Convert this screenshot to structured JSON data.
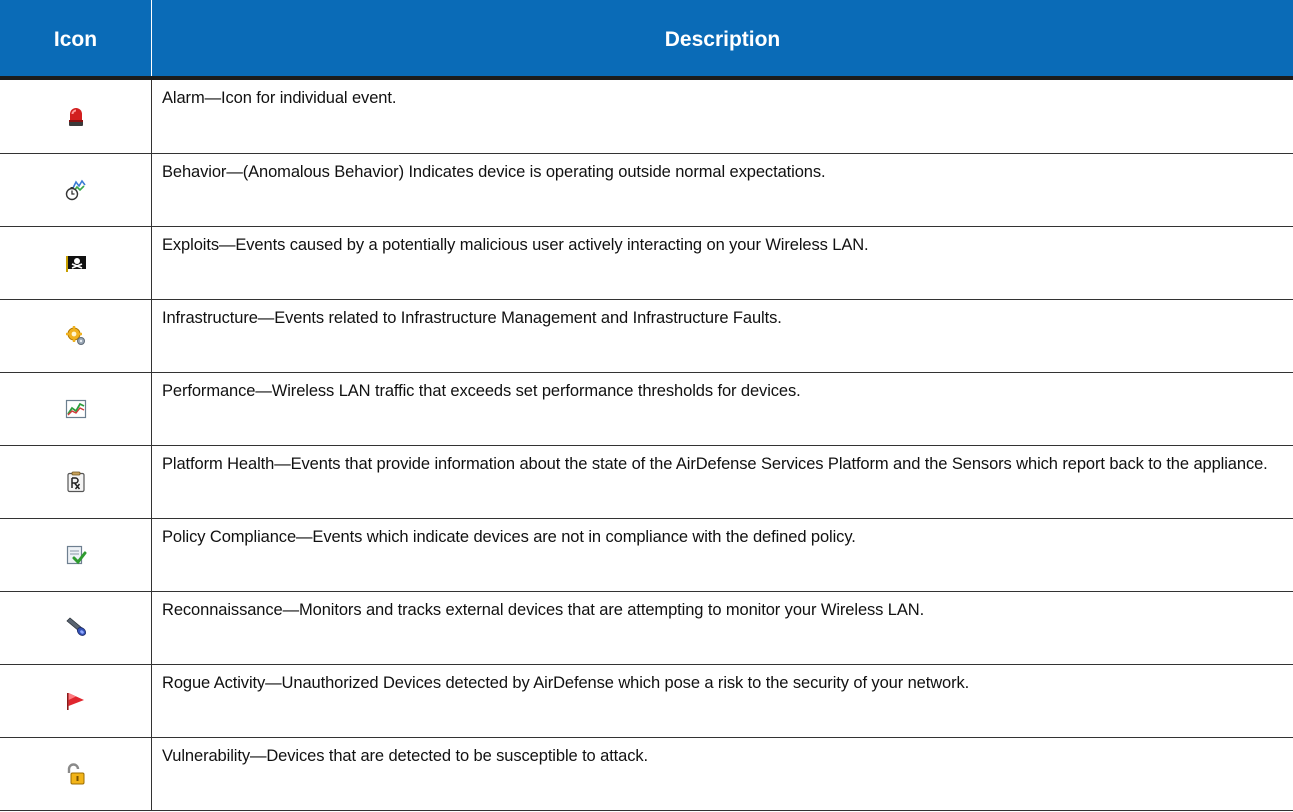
{
  "header": {
    "icon_col": "Icon",
    "description_col": "Description"
  },
  "rows": [
    {
      "icon": "alarm-icon",
      "description": "Alarm—Icon for individual event."
    },
    {
      "icon": "behavior-icon",
      "description": "Behavior—(Anomalous Behavior) Indicates device is operating outside normal expectations."
    },
    {
      "icon": "exploits-icon",
      "description": "Exploits—Events caused by a potentially malicious user actively interacting on your Wireless LAN."
    },
    {
      "icon": "infrastructure-icon",
      "description": "Infrastructure—Events related to Infrastructure Management and Infrastructure Faults."
    },
    {
      "icon": "performance-icon",
      "description": "Performance—Wireless LAN traffic that exceeds set performance thresholds for devices."
    },
    {
      "icon": "platform-health-icon",
      "description": "Platform Health—Events that provide information about the state of the AirDefense Services Platform and the Sensors which report back to the appliance."
    },
    {
      "icon": "policy-compliance-icon",
      "description": "Policy Compliance—Events which indicate devices are not in compliance with the defined policy."
    },
    {
      "icon": "reconnaissance-icon",
      "description": "Reconnaissance—Monitors and tracks external devices that are attempting to monitor your Wireless LAN."
    },
    {
      "icon": "rogue-activity-icon",
      "description": "Rogue Activity—Unauthorized Devices detected by AirDefense which pose a risk to the security of your network."
    },
    {
      "icon": "vulnerability-icon",
      "description": "Vulnerability—Devices that are detected to be susceptible to attack."
    }
  ],
  "colors": {
    "header_bg": "#0a6bb7",
    "header_text": "#ffffff",
    "border": "#333333"
  }
}
